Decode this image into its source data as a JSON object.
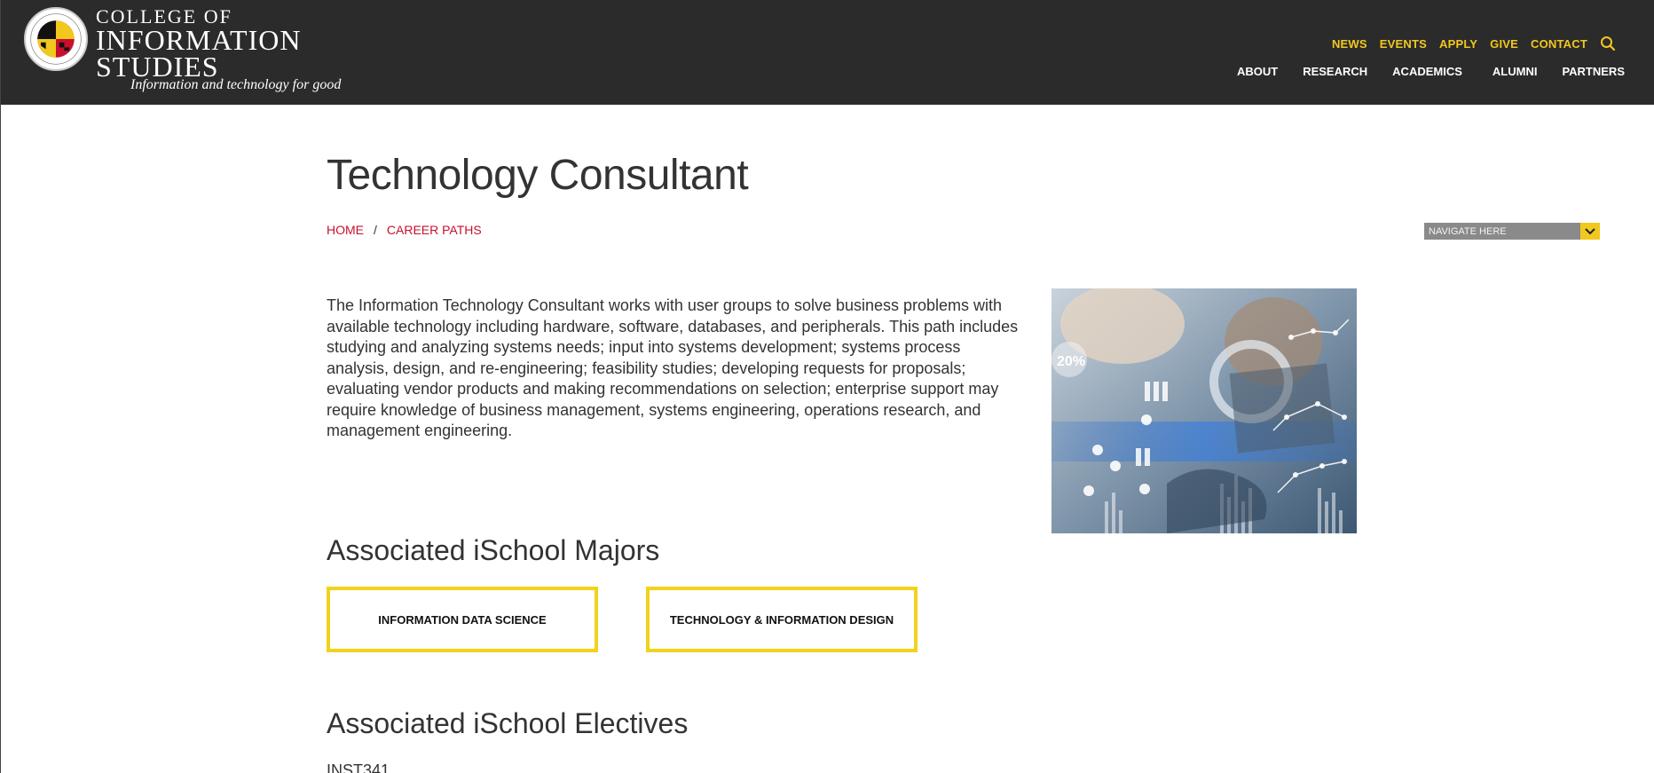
{
  "header": {
    "wordmark": {
      "line1": "COLLEGE OF",
      "line2": "INFORMATION",
      "line3": "STUDIES"
    },
    "tagline": "Information and technology for good",
    "seal_text": "UNIVERSITY OF MARYLAND",
    "utility_nav": [
      "NEWS",
      "EVENTS",
      "APPLY",
      "GIVE",
      "CONTACT"
    ],
    "main_nav": [
      "ABOUT",
      "RESEARCH",
      "ACADEMICS",
      "ALUMNI",
      "PARTNERS"
    ],
    "search_icon": "search-icon",
    "colors": {
      "bar": "#2b2b2b",
      "accent": "#f2c81f"
    }
  },
  "page": {
    "title": "Technology Consultant",
    "breadcrumb": {
      "home": "HOME",
      "separator": "/",
      "current": "CAREER PATHS"
    },
    "navigate_select": "NAVIGATE HERE",
    "intro": "The Information Technology Consultant works with user groups to solve business problems with available technology including hardware, software, databases, and peripherals. This path includes studying and analyzing systems needs; input into systems development; systems process analysis, design, and re-engineering; feasibility studies; developing requests for proposals; evaluating vendor products and making recommendations on selection; enterprise support may require knowledge of business management, systems engineering, operations research, and management engineering.",
    "hero_image_label": "20%",
    "majors_heading": "Associated iSchool Majors",
    "majors": [
      "INFORMATION DATA SCIENCE",
      "TECHNOLOGY & INFORMATION DESIGN"
    ],
    "electives_heading": "Associated iSchool Electives",
    "electives": [
      "INST341"
    ],
    "colors": {
      "link": "#c8102e",
      "button_border": "#f2d21b"
    }
  }
}
